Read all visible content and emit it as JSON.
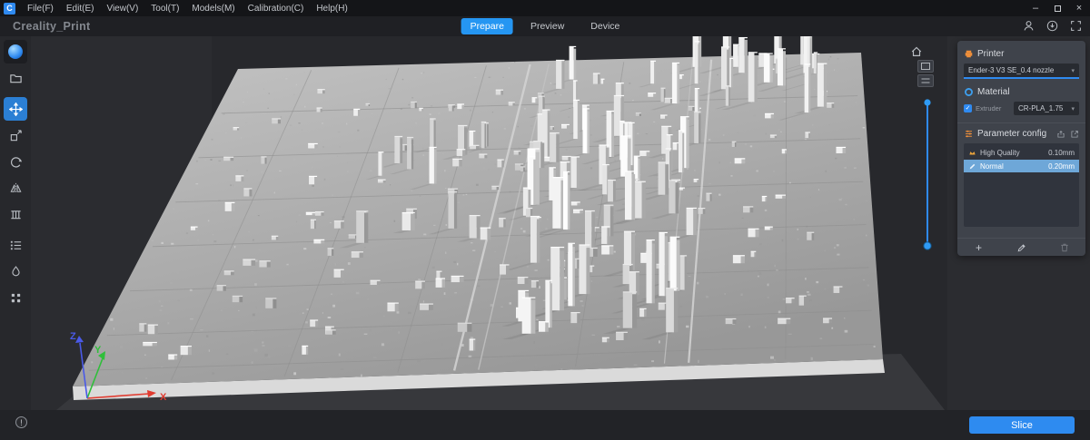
{
  "app": {
    "logo_letter": "C"
  },
  "menubar": {
    "items": [
      "File(F)",
      "Edit(E)",
      "View(V)",
      "Tool(T)",
      "Models(M)",
      "Calibration(C)",
      "Help(H)"
    ]
  },
  "titlebar": {
    "app_title": "Creality_Print"
  },
  "tabs": {
    "prepare": "Prepare",
    "preview": "Preview",
    "device": "Device"
  },
  "right_panel": {
    "printer": {
      "title": "Printer",
      "selected": "Ender-3 V3 SE_0.4 nozzle"
    },
    "material": {
      "title": "Material",
      "extruder_label": "Extruder",
      "selected": "CR-PLA_1.75"
    },
    "parameter_config": {
      "title": "Parameter config",
      "presets": [
        {
          "name": "High Quality",
          "value": "0.10mm"
        },
        {
          "name": "Normal",
          "value": "0.20mm"
        }
      ],
      "add_label": "+"
    }
  },
  "viewport": {
    "axes": {
      "x": "X",
      "y": "Y",
      "z": "Z"
    },
    "info_badge": "!"
  },
  "actions": {
    "slice": "Slice"
  },
  "icons": {
    "chevron_down": "▾",
    "check": "✓",
    "minimize": "–",
    "close": "×"
  },
  "colors": {
    "accent": "#2f8af0",
    "active_tab": "#2596f2",
    "selected_preset": "#6ea7d8",
    "panel": "#3f434b"
  }
}
